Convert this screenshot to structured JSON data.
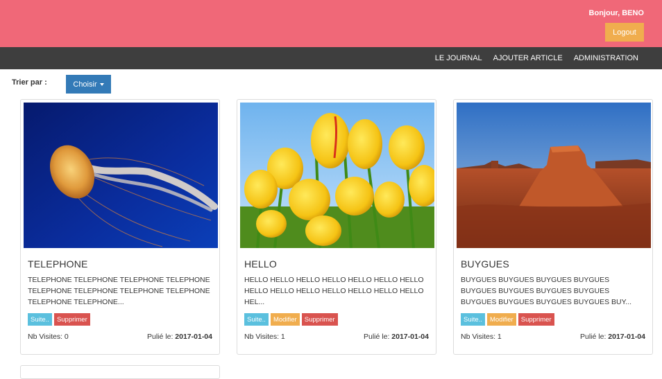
{
  "header": {
    "greeting": "Bonjour, BENO",
    "logout_label": "Logout"
  },
  "nav": {
    "items": [
      {
        "label": "LE JOURNAL"
      },
      {
        "label": "AJOUTER ARTICLE"
      },
      {
        "label": "ADMINISTRATION"
      }
    ]
  },
  "sort": {
    "label": "Trier par :",
    "button_label": "Choisir"
  },
  "cards": [
    {
      "title": "TELEPHONE",
      "excerpt": "TELEPHONE TELEPHONE TELEPHONE TELEPHONE TELEPHONE TELEPHONE TELEPHONE TELEPHONE TELEPHONE TELEPHONE...",
      "buttons": [
        "Suite..",
        "Supprimer"
      ],
      "visits": "Nb Visites: 0",
      "published_label": "Pulié le:",
      "published_date": "2017-01-04",
      "image": "jellyfish"
    },
    {
      "title": "HELLO",
      "excerpt": "HELLO HELLO HELLO HELLO HELLO HELLO HELLO HELLO HELLO HELLO HELLO HELLO HELLO HELLO HEL...",
      "buttons": [
        "Suite..",
        "Modifier",
        "Supprimer"
      ],
      "visits": "Nb Visites: 1",
      "published_label": "Pulié le:",
      "published_date": "2017-01-04",
      "image": "tulips"
    },
    {
      "title": "BUYGUES",
      "excerpt": "BUYGUES BUYGUES BUYGUES BUYGUES BUYGUES BUYGUES BUYGUES BUYGUES BUYGUES BUYGUES BUYGUES BUYGUES BUY...",
      "buttons": [
        "Suite..",
        "Modifier",
        "Supprimer"
      ],
      "visits": "Nb Visites: 1",
      "published_label": "Pulié le:",
      "published_date": "2017-01-04",
      "image": "desert"
    }
  ],
  "colors": {
    "header_bg": "#f06878",
    "navbar_bg": "#3e3e3e",
    "primary": "#337ab7",
    "info": "#5bc0de",
    "warning": "#f0ad4e",
    "danger": "#d9534f"
  }
}
